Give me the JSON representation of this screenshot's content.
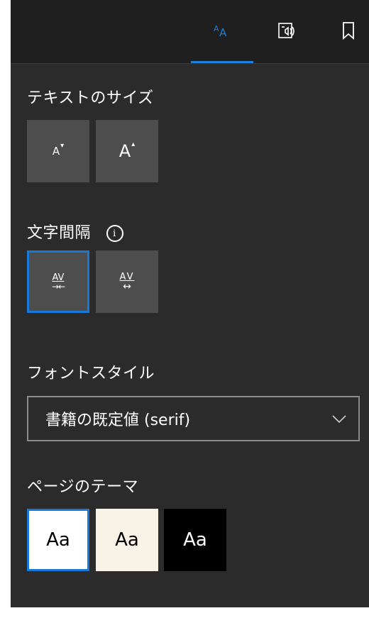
{
  "tabs": [
    {
      "icon": "text-options-icon",
      "selected": true
    },
    {
      "icon": "read-aloud-icon",
      "selected": false
    },
    {
      "icon": "bookmark-icon",
      "selected": false
    }
  ],
  "text_size": {
    "title": "テキストのサイズ",
    "decrease_label": "A",
    "increase_label": "A"
  },
  "spacing": {
    "title": "文字間隔",
    "info_glyph": "i",
    "narrow_label": "AV",
    "wide_label": "AV"
  },
  "font_style": {
    "title": "フォントスタイル",
    "selected": "書籍の既定値 (serif)"
  },
  "theme": {
    "title": "ページのテーマ",
    "options": [
      {
        "label": "Aa",
        "bg": "#ffffff",
        "fg": "#000000",
        "selected": true
      },
      {
        "label": "Aa",
        "bg": "#f8f3e6",
        "fg": "#000000",
        "selected": false
      },
      {
        "label": "Aa",
        "bg": "#000000",
        "fg": "#ffffff",
        "selected": false
      }
    ]
  },
  "colors": {
    "accent": "#1a78d6",
    "panel": "#2b2b2b",
    "button": "#4d4d4d"
  }
}
